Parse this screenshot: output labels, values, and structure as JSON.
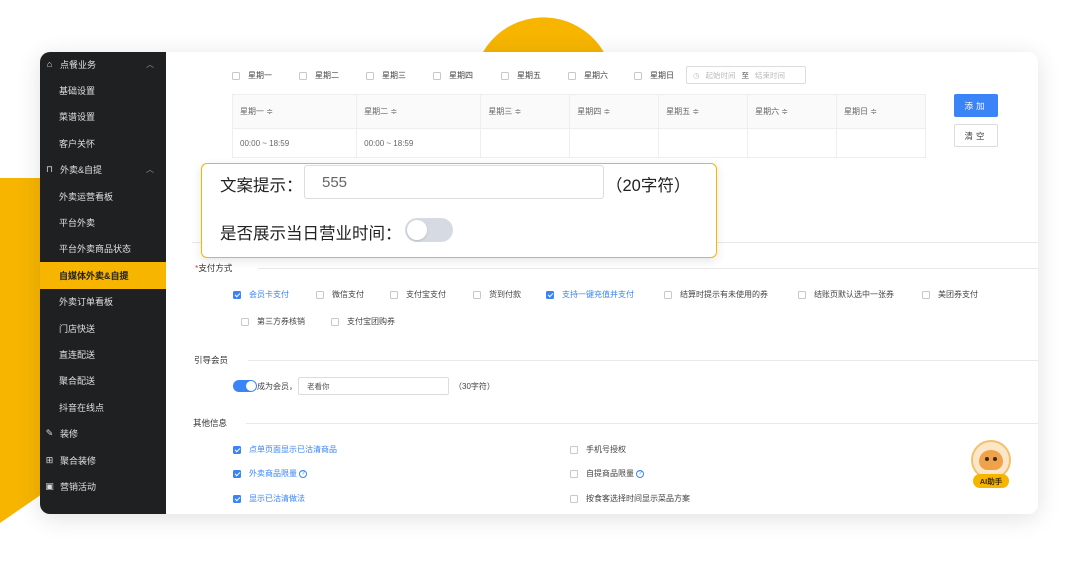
{
  "sidebar": {
    "items": [
      {
        "label": "点餐业务",
        "type": "group",
        "icon": "store-icon",
        "chevron": "︿"
      },
      {
        "label": "基础设置",
        "type": "item"
      },
      {
        "label": "菜谱设置",
        "type": "item"
      },
      {
        "label": "客户关怀",
        "type": "item"
      },
      {
        "label": "外卖&自提",
        "type": "group",
        "icon": "bag-icon",
        "chevron": "︿"
      },
      {
        "label": "外卖运营看板",
        "type": "item"
      },
      {
        "label": "平台外卖",
        "type": "item"
      },
      {
        "label": "平台外卖商品状态",
        "type": "item"
      },
      {
        "label": "自媒体外卖&自提",
        "type": "item",
        "active": true
      },
      {
        "label": "外卖订单看板",
        "type": "item"
      },
      {
        "label": "门店快送",
        "type": "item"
      },
      {
        "label": "直连配送",
        "type": "item"
      },
      {
        "label": "聚合配送",
        "type": "item"
      },
      {
        "label": "抖音在线点",
        "type": "item"
      },
      {
        "label": "装修",
        "type": "group",
        "icon": "brush-icon"
      },
      {
        "label": "聚合装修",
        "type": "group",
        "icon": "layout-icon"
      },
      {
        "label": "营销活动",
        "type": "group",
        "icon": "gift-icon"
      }
    ]
  },
  "weekdays": {
    "options": [
      {
        "label": "星期一",
        "checked": false
      },
      {
        "label": "星期二",
        "checked": false
      },
      {
        "label": "星期三",
        "checked": false
      },
      {
        "label": "星期四",
        "checked": false
      },
      {
        "label": "星期五",
        "checked": false
      },
      {
        "label": "星期六",
        "checked": false
      },
      {
        "label": "星期日",
        "checked": false
      }
    ],
    "start_placeholder": "起始时间",
    "separator": "至",
    "end_placeholder": "结束时间"
  },
  "schedule_table": {
    "headers": [
      "星期一 ≑",
      "星期二 ≑",
      "星期三 ≑",
      "星期四 ≑",
      "星期五 ≑",
      "星期六 ≑",
      "星期日 ≑"
    ],
    "row": [
      "00:00 ~ 18:59",
      "00:00 ~ 18:59",
      "",
      "",
      "",
      "",
      ""
    ]
  },
  "buttons": {
    "add": "添加",
    "clear": "清空"
  },
  "zoom": {
    "hint_label": "文案提示：",
    "hint_value": "555",
    "hint_limit": "（20字符）",
    "show_hours_label": "是否展示当日营业时间：",
    "show_hours_on": false
  },
  "payment": {
    "title": "支付方式",
    "required_mark": "*",
    "options": [
      {
        "label": "会员卡支付",
        "checked": true
      },
      {
        "label": "微信支付",
        "checked": false
      },
      {
        "label": "支付宝支付",
        "checked": false
      },
      {
        "label": "货到付款",
        "checked": false
      },
      {
        "label": "支持一键充值并支付",
        "checked": true
      },
      {
        "label": "结算时提示有未使用的券",
        "checked": false
      },
      {
        "label": "结账页默认选中一张券",
        "checked": false
      },
      {
        "label": "美团券支付",
        "checked": false
      },
      {
        "label": "第三方券核销",
        "checked": false
      },
      {
        "label": "支付宝团购券",
        "checked": false
      }
    ]
  },
  "member": {
    "title": "引导会员",
    "toggle_on": true,
    "label": "成为会员，",
    "input_value": "老看你",
    "limit": "（30字符）"
  },
  "other": {
    "title": "其他信息",
    "options": [
      {
        "label": "点单页面显示已沽清商品",
        "checked": true
      },
      {
        "label": "手机号授权",
        "checked": false
      },
      {
        "label": "外卖商品限量",
        "checked": true,
        "help": "?"
      },
      {
        "label": "自提商品限量",
        "checked": false,
        "help": "?"
      },
      {
        "label": "显示已沽清做法",
        "checked": true
      },
      {
        "label": "按食客选择时间显示菜品方案",
        "checked": false
      }
    ]
  },
  "ai_helper": {
    "label": "AI助手"
  },
  "colors": {
    "accent": "#f7b500",
    "primary": "#3a84f7",
    "sidebar": "#1f2021"
  }
}
